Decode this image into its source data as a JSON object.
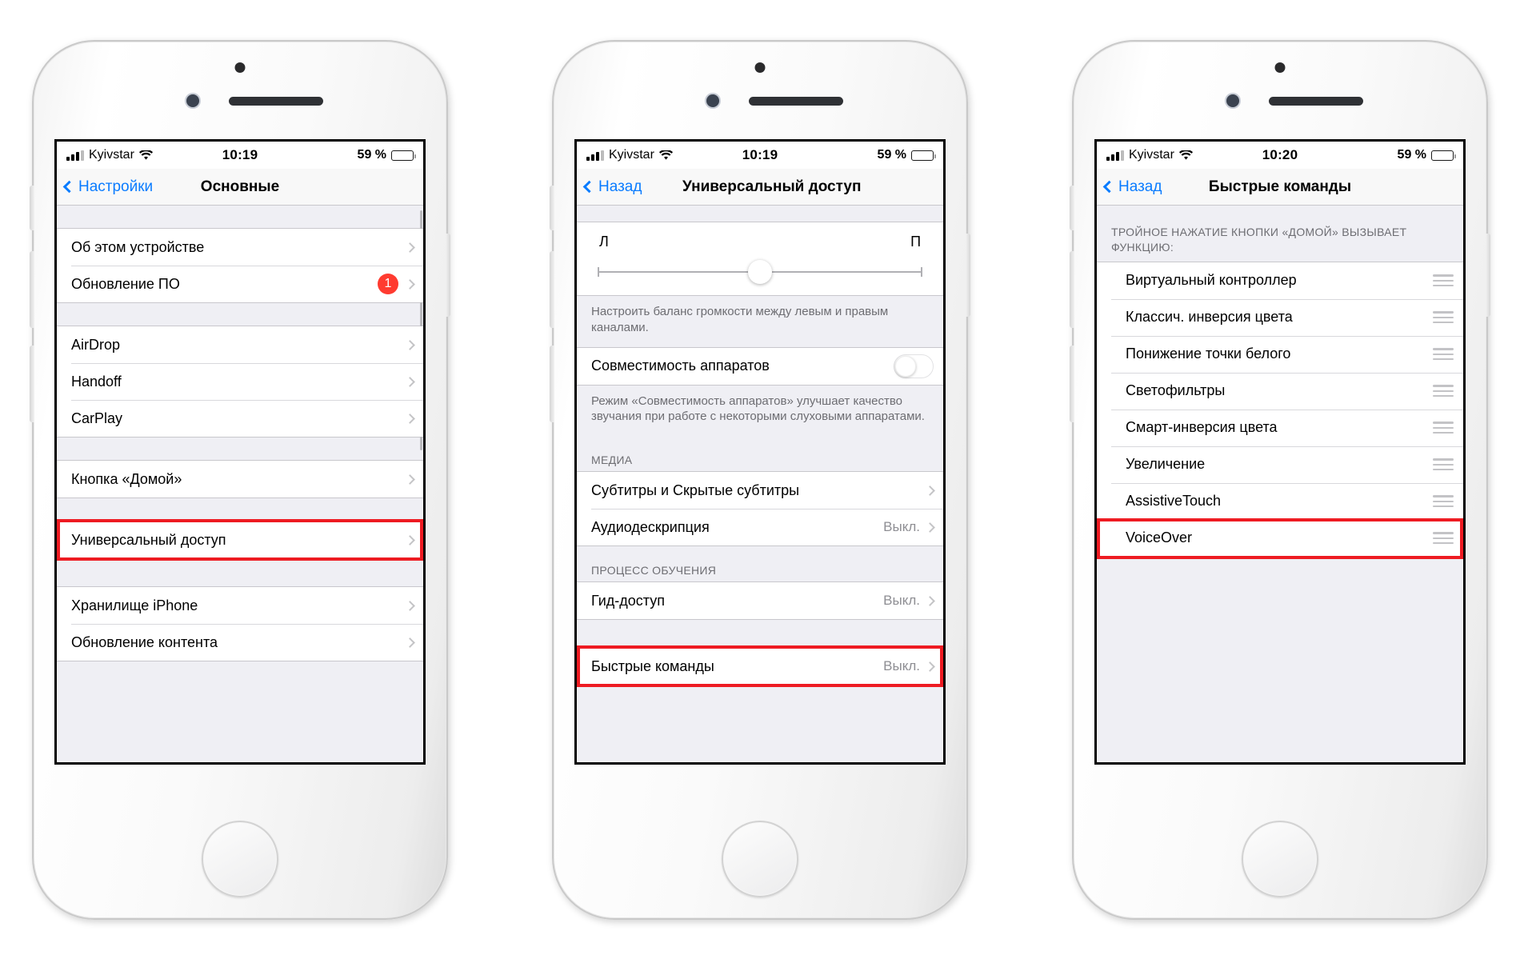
{
  "phones": [
    {
      "id": "phone-general-settings",
      "status": {
        "carrier": "Kyivstar",
        "time": "10:19",
        "battery": "59 %",
        "battery_level": 59
      },
      "nav": {
        "back_label": "Настройки",
        "title": "Основные"
      },
      "sections": [
        {
          "rows": [
            {
              "label": "Об этом устройстве",
              "chevron": true
            },
            {
              "label": "Обновление ПО",
              "badge": "1",
              "chevron": true
            }
          ]
        },
        {
          "rows": [
            {
              "label": "AirDrop",
              "chevron": true
            },
            {
              "label": "Handoff",
              "chevron": true
            },
            {
              "label": "CarPlay",
              "chevron": true
            }
          ]
        },
        {
          "rows": [
            {
              "label": "Кнопка «Домой»",
              "chevron": true
            }
          ]
        },
        {
          "highlighted": true,
          "rows": [
            {
              "label": "Универсальный доступ",
              "chevron": true
            }
          ]
        },
        {
          "rows": [
            {
              "label": "Хранилище iPhone",
              "chevron": true
            },
            {
              "label": "Обновление контента",
              "chevron": true
            }
          ]
        }
      ]
    },
    {
      "id": "phone-accessibility",
      "status": {
        "carrier": "Kyivstar",
        "time": "10:19",
        "battery": "59 %",
        "battery_level": 59
      },
      "nav": {
        "back_label": "Назад",
        "title": "Универсальный доступ"
      },
      "slider": {
        "left_label": "Л",
        "right_label": "П",
        "value": 50
      },
      "slider_footnote": "Настроить баланс громкости между левым и правым каналами.",
      "hearing_row": {
        "label": "Совместимость аппаратов",
        "toggle": "off"
      },
      "hearing_footnote": "Режим «Совместимость аппаратов» улучшает качество звучания при работе с некоторыми слуховыми аппаратами.",
      "media_header": "МЕДИА",
      "media_rows": [
        {
          "label": "Субтитры и Скрытые субтитры",
          "chevron": true
        },
        {
          "label": "Аудиодескрипция",
          "value": "Выкл.",
          "chevron": true
        }
      ],
      "learning_header": "ПРОЦЕСС ОБУЧЕНИЯ",
      "learning_rows": [
        {
          "label": "Гид-доступ",
          "value": "Выкл.",
          "chevron": true
        }
      ],
      "shortcut_row": {
        "label": "Быстрые команды",
        "value": "Выкл.",
        "chevron": true,
        "highlighted": true
      }
    },
    {
      "id": "phone-shortcuts",
      "status": {
        "carrier": "Kyivstar",
        "time": "10:20",
        "battery": "59 %",
        "battery_level": 59
      },
      "nav": {
        "back_label": "Назад",
        "title": "Быстрые команды"
      },
      "section_header": "ТРОЙНОЕ НАЖАТИЕ КНОПКИ «ДОМОЙ» ВЫЗЫВАЕТ ФУНКЦИЮ:",
      "rows": [
        {
          "label": "Виртуальный контроллер",
          "handle": true
        },
        {
          "label": "Классич. инверсия цвета",
          "handle": true
        },
        {
          "label": "Понижение точки белого",
          "handle": true
        },
        {
          "label": "Светофильтры",
          "handle": true
        },
        {
          "label": "Смарт-инверсия цвета",
          "handle": true
        },
        {
          "label": "Увеличение",
          "handle": true
        },
        {
          "label": "AssistiveTouch",
          "handle": true
        },
        {
          "label": "VoiceOver",
          "handle": true,
          "highlighted": true
        }
      ]
    }
  ],
  "colors": {
    "accent_blue": "#0a7cff",
    "highlight_red": "#ee1b22",
    "badge_red": "#ff3b30",
    "list_bg": "#efeff4",
    "separator": "#c8c7cc",
    "secondary_text": "#8e8e93"
  },
  "icons": {
    "signal": "signal-bars-icon",
    "wifi": "wifi-icon",
    "battery": "battery-icon",
    "chevron_right": "chevron-right-icon",
    "chevron_left": "chevron-left-icon",
    "reorder": "reorder-handle-icon"
  }
}
